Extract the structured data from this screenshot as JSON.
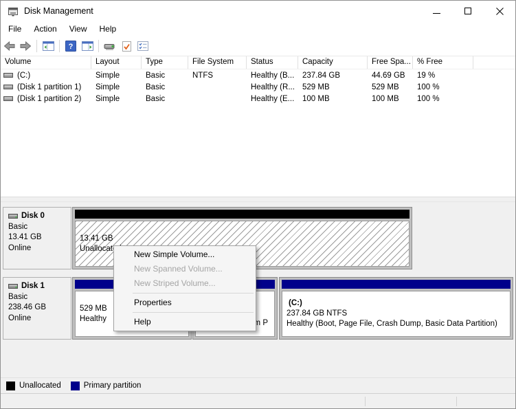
{
  "window": {
    "title": "Disk Management"
  },
  "window_controls": {
    "icons": [
      "minimize-icon",
      "maximize-icon",
      "close-icon"
    ]
  },
  "menu_bar": {
    "items": [
      {
        "label": "File"
      },
      {
        "label": "Action"
      },
      {
        "label": "View"
      },
      {
        "label": "Help"
      }
    ]
  },
  "toolbar": {
    "icons": [
      "back-icon",
      "forward-icon",
      "show-console-tree-icon",
      "help-icon",
      "show-action-pane-icon",
      "rescan-disks-icon",
      "check-icon",
      "properties-icon"
    ]
  },
  "volume_table": {
    "columns": [
      {
        "label": "Volume"
      },
      {
        "label": "Layout"
      },
      {
        "label": "Type"
      },
      {
        "label": "File System"
      },
      {
        "label": "Status"
      },
      {
        "label": "Capacity"
      },
      {
        "label": "Free Spa..."
      },
      {
        "label": "% Free"
      },
      {
        "label": ""
      }
    ],
    "rows": [
      {
        "volume": "(C:)",
        "layout": "Simple",
        "type": "Basic",
        "fs": "NTFS",
        "status": "Healthy (B...",
        "capacity": "237.84 GB",
        "free": "44.69 GB",
        "pct": "19 %"
      },
      {
        "volume": "(Disk 1 partition 1)",
        "layout": "Simple",
        "type": "Basic",
        "fs": "",
        "status": "Healthy (R...",
        "capacity": "529 MB",
        "free": "529 MB",
        "pct": "100 %"
      },
      {
        "volume": "(Disk 1 partition 2)",
        "layout": "Simple",
        "type": "Basic",
        "fs": "",
        "status": "Healthy (E...",
        "capacity": "100 MB",
        "free": "100 MB",
        "pct": "100 %"
      }
    ]
  },
  "graphical_view": {
    "disk0": {
      "name": "Disk 0",
      "type": "Basic",
      "size": "13.41 GB",
      "status": "Online",
      "region": {
        "size_line": "13.41 GB",
        "status_line": "Unallocated"
      }
    },
    "disk1": {
      "name": "Disk 1",
      "type": "Basic",
      "size": "238.46 GB",
      "status": "Online",
      "partitions": [
        {
          "size_line": "529 MB",
          "status_line": "Healthy"
        },
        {
          "visible_fragment": "em P"
        },
        {
          "name": "(C:)",
          "size_line": "237.84 GB NTFS",
          "status_line": "Healthy (Boot, Page File, Crash Dump, Basic Data Partition)"
        }
      ]
    }
  },
  "context_menu": {
    "items": [
      {
        "label": "New Simple Volume...",
        "enabled": true
      },
      {
        "label": "New Spanned Volume...",
        "enabled": false
      },
      {
        "label": "New Striped Volume...",
        "enabled": false
      },
      {
        "label": "Properties",
        "enabled": true
      },
      {
        "label": "Help",
        "enabled": true
      }
    ]
  },
  "legend": {
    "items": [
      {
        "label": "Unallocated",
        "color": "#000000"
      },
      {
        "label": "Primary partition",
        "color": "#00008b"
      }
    ]
  },
  "colors": {
    "unallocated_band": "#000000",
    "primary_band": "#00008b",
    "pane_bg": "#f0f0f0"
  }
}
